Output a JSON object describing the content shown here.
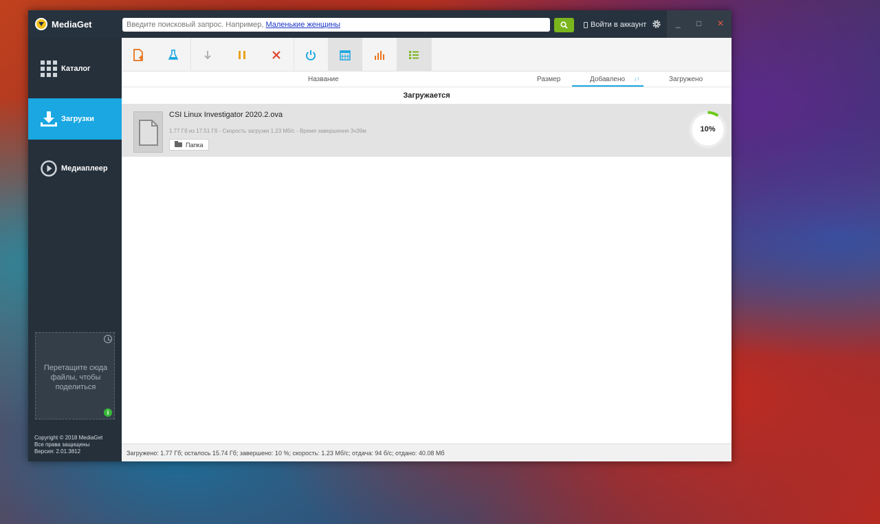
{
  "app": {
    "name": "MediaGet"
  },
  "search": {
    "placeholder": "Введите поисковый запрос. Например,",
    "example_link": "Маленькие женщины"
  },
  "header": {
    "login_label": "Войти в аккаунт"
  },
  "window_controls": {
    "minimize": "_",
    "maximize": "□",
    "close": "✕"
  },
  "sidebar": {
    "items": [
      {
        "label": "Каталог",
        "icon": "grid-icon"
      },
      {
        "label": "Загрузки",
        "icon": "download-icon",
        "active": true
      },
      {
        "label": "Медиаплеер",
        "icon": "play-icon"
      }
    ],
    "dropzone_text": "Перетащите сюда файлы, чтобы поделиться",
    "info_glyph": "i",
    "copyright": "Copyright © 2018 MediaGet",
    "rights": "Все права защищены",
    "version": "Версия: 2.01.3812"
  },
  "toolbar": {
    "buttons": [
      "new-torrent-icon",
      "flask-icon",
      "download-arrow-icon",
      "pause-icon",
      "cancel-icon",
      "power-icon",
      "calendar-icon",
      "stats-icon",
      "list-icon"
    ]
  },
  "columns": {
    "name": "Название",
    "size": "Размер",
    "added": "Добавлено",
    "downloaded": "Загружено",
    "sort_glyph": "↓↑"
  },
  "group": {
    "title": "Загружается"
  },
  "downloads": [
    {
      "name": "CSI Linux Investigator 2020.2.ova",
      "stats": "1.77 Гб из 17.51 Гб - Скорость загрузки 1.23 Мб/с - Время завершения 3ч39м",
      "folder_label": "Папка",
      "progress": 0.1,
      "progress_label": "10%"
    }
  ],
  "status_bar": "Загружено: 1.77 Гб; осталось 15.74 Гб; завершено: 10 %; скорость: 1.23 Мб/с; отдача: 94 б/с; отдано: 40.08 Мб",
  "colors": {
    "sidebar_bg": "#25303b",
    "accent_blue": "#1aa7e2",
    "accent_green": "#7ab51d",
    "progress_green": "#6cc91a"
  }
}
